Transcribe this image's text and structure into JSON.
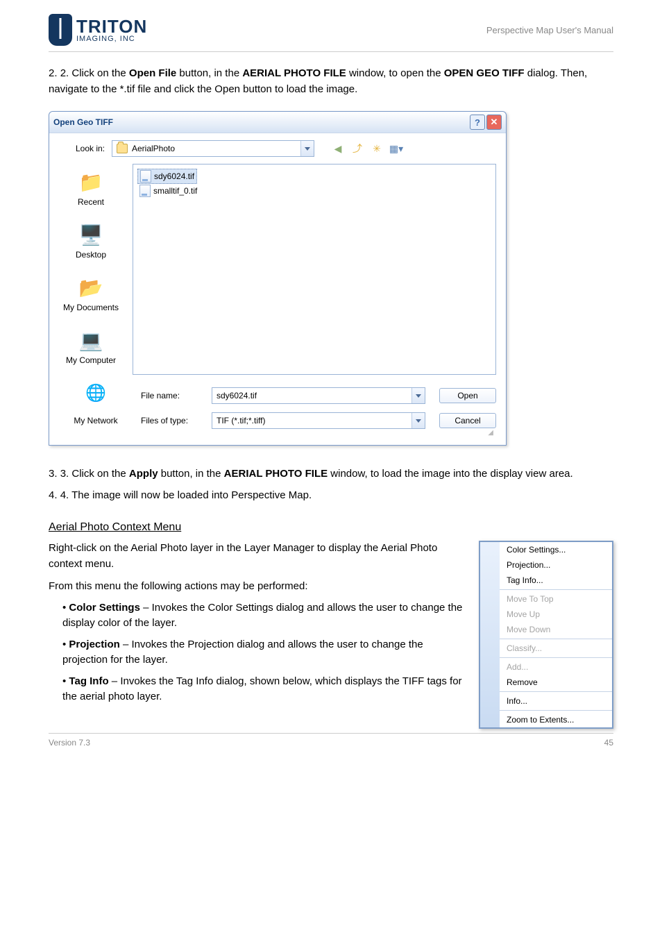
{
  "header": {
    "logo_main": "TRITON",
    "logo_sub": "IMAGING, INC",
    "doc_title": "Perspective Map User's Manual"
  },
  "paragraphs": {
    "intro1": "2. Click on the ",
    "intro_bold1": "Open File ",
    "intro2": "button, in the ",
    "intro_bold2": "AERIAL PHOTO FILE ",
    "intro3": "window, to open the ",
    "intro_bold3": "OPEN GEO TIFF ",
    "intro4": "dialog. Then, navigate to the *.tif file and click the Open button to load the image.",
    "after_dialog1": "3. Click on the ",
    "after_bold1": "Apply ",
    "after_dialog2": "button, in the ",
    "after_bold2": "AERIAL PHOTO FILE ",
    "after_dialog3": "window, to load the image into the display view area.",
    "after2": "4. The image will now be loaded into Perspective Map."
  },
  "heading": "Aerial Photo Context Menu",
  "context_text": {
    "p1": "Right-click on the Aerial Photo layer in the Layer Manager to display the Aerial Photo context menu.",
    "lead": "From this menu the following actions may be performed:",
    "b1a": "Color Settings",
    "b1b": " – Invokes the Color Settings dialog and allows the user to change the display color of the layer.",
    "b2a": "Projection ",
    "b2b": "– Invokes the Projection dialog and allows the user to change the projection for the layer.",
    "b3a": "Tag Info",
    "b3b": " – Invokes the Tag Info dialog, shown below, which displays the TIFF tags for the aerial photo layer."
  },
  "dialog": {
    "title": "Open Geo TIFF",
    "look_in_label": "Look in:",
    "look_in_value": "AerialPhoto",
    "files": [
      "sdy6024.tif",
      "smalltif_0.tif"
    ],
    "places": [
      "Recent",
      "Desktop",
      "My Documents",
      "My Computer",
      "My Network"
    ],
    "file_name_label": "File name:",
    "file_name_value": "sdy6024.tif",
    "file_type_label": "Files of type:",
    "file_type_value": "TIF (*.tif;*.tiff)",
    "open_btn": "Open",
    "cancel_btn": "Cancel"
  },
  "context_menu": {
    "items": [
      {
        "label": "Color Settings...",
        "enabled": true
      },
      {
        "label": "Projection...",
        "enabled": true
      },
      {
        "label": "Tag Info...",
        "enabled": true
      },
      {
        "sep": true
      },
      {
        "label": "Move To Top",
        "enabled": false
      },
      {
        "label": "Move Up",
        "enabled": false
      },
      {
        "label": "Move Down",
        "enabled": false
      },
      {
        "sep": true
      },
      {
        "label": "Classify...",
        "enabled": false
      },
      {
        "sep": true
      },
      {
        "label": "Add...",
        "enabled": false
      },
      {
        "label": "Remove",
        "enabled": true
      },
      {
        "sep": true
      },
      {
        "label": "Info...",
        "enabled": true
      },
      {
        "sep": true
      },
      {
        "label": "Zoom to Extents...",
        "enabled": true
      }
    ]
  },
  "footer": {
    "version": "Version 7.3",
    "page": "45"
  }
}
